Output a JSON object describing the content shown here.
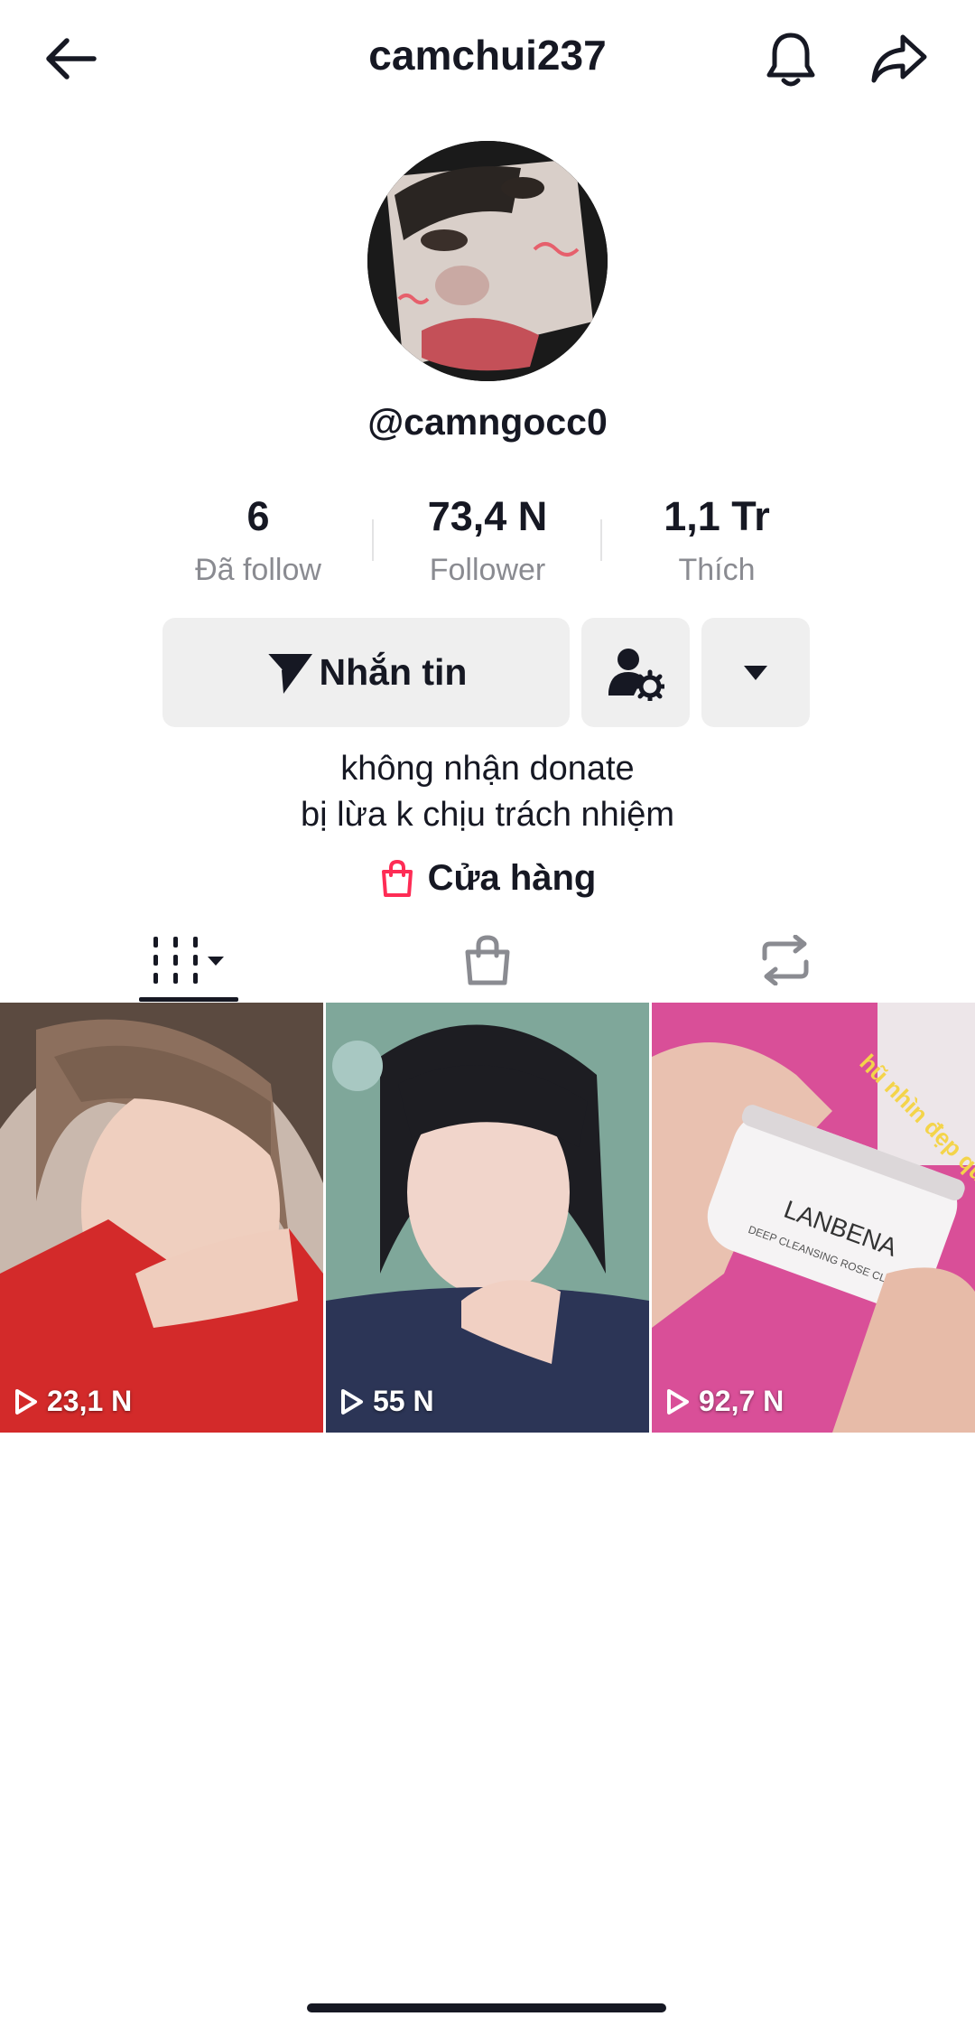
{
  "header": {
    "title": "camchui237",
    "back_icon": "arrow-left-icon",
    "bell_icon": "bell-icon",
    "share_icon": "share-icon"
  },
  "profile": {
    "handle": "@camngocc0",
    "stats": [
      {
        "value": "6",
        "label": "Đã follow"
      },
      {
        "value": "73,4 N",
        "label": "Follower"
      },
      {
        "value": "1,1 Tr",
        "label": "Thích"
      }
    ]
  },
  "actions": {
    "message_label": "Nhắn tin",
    "message_icon": "paper-plane-icon",
    "add_friend_icon": "user-settings-icon",
    "more_icon": "caret-down-icon"
  },
  "bio": {
    "line1": "không nhận  donate",
    "line2": "bị lừa k chịu trách nhiệm"
  },
  "shop": {
    "label": "Cửa hàng",
    "icon": "shopping-bag-icon",
    "color": "#fe2c55"
  },
  "tabs": [
    {
      "name": "videos",
      "icon": "grid-bars-icon",
      "active": true
    },
    {
      "name": "shop",
      "icon": "bag-icon",
      "active": false
    },
    {
      "name": "reposts",
      "icon": "repost-icon",
      "active": false
    }
  ],
  "videos": [
    {
      "views": "23,1 N"
    },
    {
      "views": "55 N"
    },
    {
      "views": "92,7 N",
      "overlay_text": "hũ nhìn đẹp quá"
    }
  ],
  "product_label": "LANBENA",
  "product_sublabel": "DEEP CLEANSING ROSE CLAY"
}
